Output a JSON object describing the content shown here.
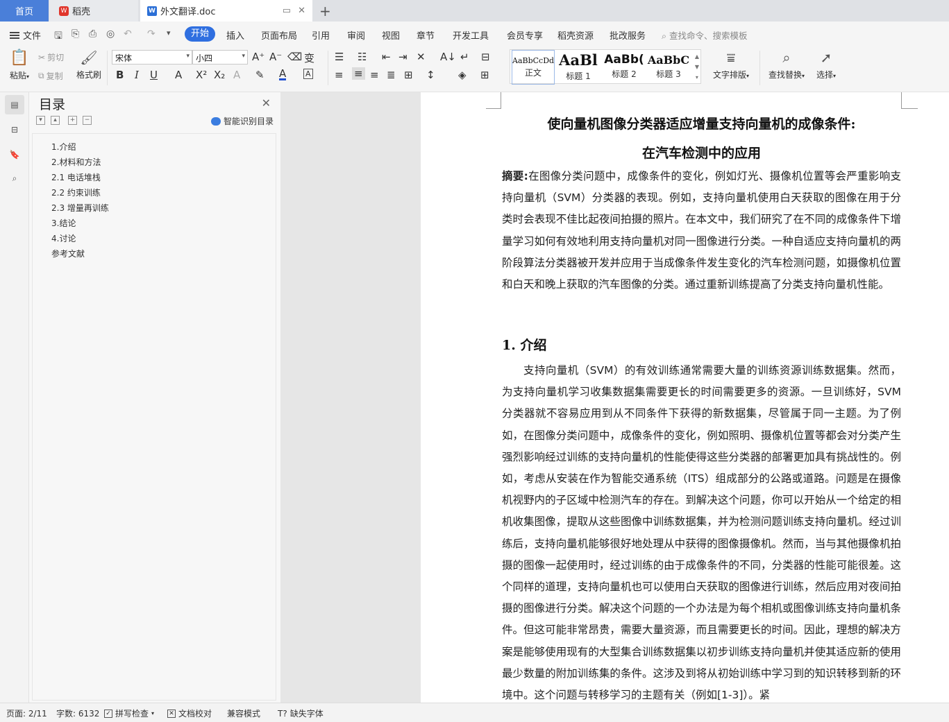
{
  "tabs": {
    "home": "首页",
    "daoke": "稻壳",
    "doc": "外文翻译.doc"
  },
  "menu": {
    "file": "文件",
    "items": [
      "开始",
      "插入",
      "页面布局",
      "引用",
      "审阅",
      "视图",
      "章节",
      "开发工具",
      "会员专享",
      "稻壳资源",
      "批改服务"
    ],
    "search": "查找命令、搜索模板"
  },
  "ribbon": {
    "paste": "粘贴",
    "cut": "剪切",
    "copy": "复制",
    "format_painter": "格式刷",
    "font_name": "宋体",
    "font_size": "小四",
    "styles": [
      {
        "sample": "AaBbCcDd",
        "name": "正文"
      },
      {
        "sample": "AaBl",
        "name": "标题 1"
      },
      {
        "sample": "AaBb(",
        "name": "标题 2"
      },
      {
        "sample": "AaBbC",
        "name": "标题 3"
      }
    ],
    "text_layout": "文字排版",
    "find_replace": "查找替换",
    "select": "选择"
  },
  "toc": {
    "title": "目录",
    "ai_label": "智能识别目录",
    "items": [
      "1.介绍",
      "2.材料和方法",
      "2.1 电话堆栈",
      "2.2 约束训练",
      "2.3 增量再训练",
      "3.结论",
      "4.讨论",
      "参考文献"
    ]
  },
  "document": {
    "title_line1": "使向量机图像分类器适应增量支持向量机的成像条件:",
    "title_line2": "在汽车检测中的应用",
    "abstract_label": "摘要:",
    "abstract_text": "在图像分类问题中，成像条件的变化，例如灯光、摄像机位置等会严重影响支持向量机（SVM）分类器的表现。例如，支持向量机使用白天获取的图像在用于分类时会表现不佳比起夜间拍摄的照片。在本文中，我们研究了在不同的成像条件下增量学习如何有效地利用支持向量机对同一图像进行分类。一种自适应支持向量机的两阶段算法分类器被开发并应用于当成像条件发生变化的汽车检测问题，如摄像机位置和白天和晚上获取的汽车图像的分类。通过重新训练提高了分类支持向量机性能。",
    "section1_heading": "1. 介绍",
    "section1_text": "支持向量机（SVM）的有效训练通常需要大量的训练资源训练数据集。然而，为支持向量机学习收集数据集需要更长的时间需要更多的资源。一旦训练好，SVM分类器就不容易应用到从不同条件下获得的新数据集，尽管属于同一主题。为了例如，在图像分类问题中，成像条件的变化，例如照明、摄像机位置等都会对分类产生强烈影响经过训练的支持向量机的性能使得这些分类器的部署更加具有挑战性的。例如，考虑从安装在作为智能交通系统（ITS）组成部分的公路或道路。问题是在摄像机视野内的子区域中检测汽车的存在。到解决这个问题，你可以开始从一个给定的相机收集图像，提取从这些图像中训练数据集，并为检测问题训练支持向量机。经过训练后，支持向量机能够很好地处理从中获得的图像摄像机。然而，当与其他摄像机拍摄的图像一起使用时，经过训练的由于成像条件的不同，分类器的性能可能很差。这个同样的道理，支持向量机也可以使用白天获取的图像进行训练，然后应用对夜间拍摄的图像进行分类。解决这个问题的一个办法是为每个相机或图像训练支持向量机条件。但这可能非常昂贵，需要大量资源，而且需要更长的时间。因此，理想的解决方案是能够使用现有的大型集合训练数据集以初步训练支持向量机并使其适应新的使用最少数量的附加训练集的条件。这涉及到将从初始训练中学习到的知识转移到新的环境中。这个问题与转移学习的主题有关（例如[1-3]）。紧"
  },
  "status": {
    "page": "页面: 2/11",
    "words": "字数: 6132",
    "spell": "拼写检查",
    "proof": "文档校对",
    "compat": "兼容模式",
    "missing_font": "缺失字体"
  }
}
